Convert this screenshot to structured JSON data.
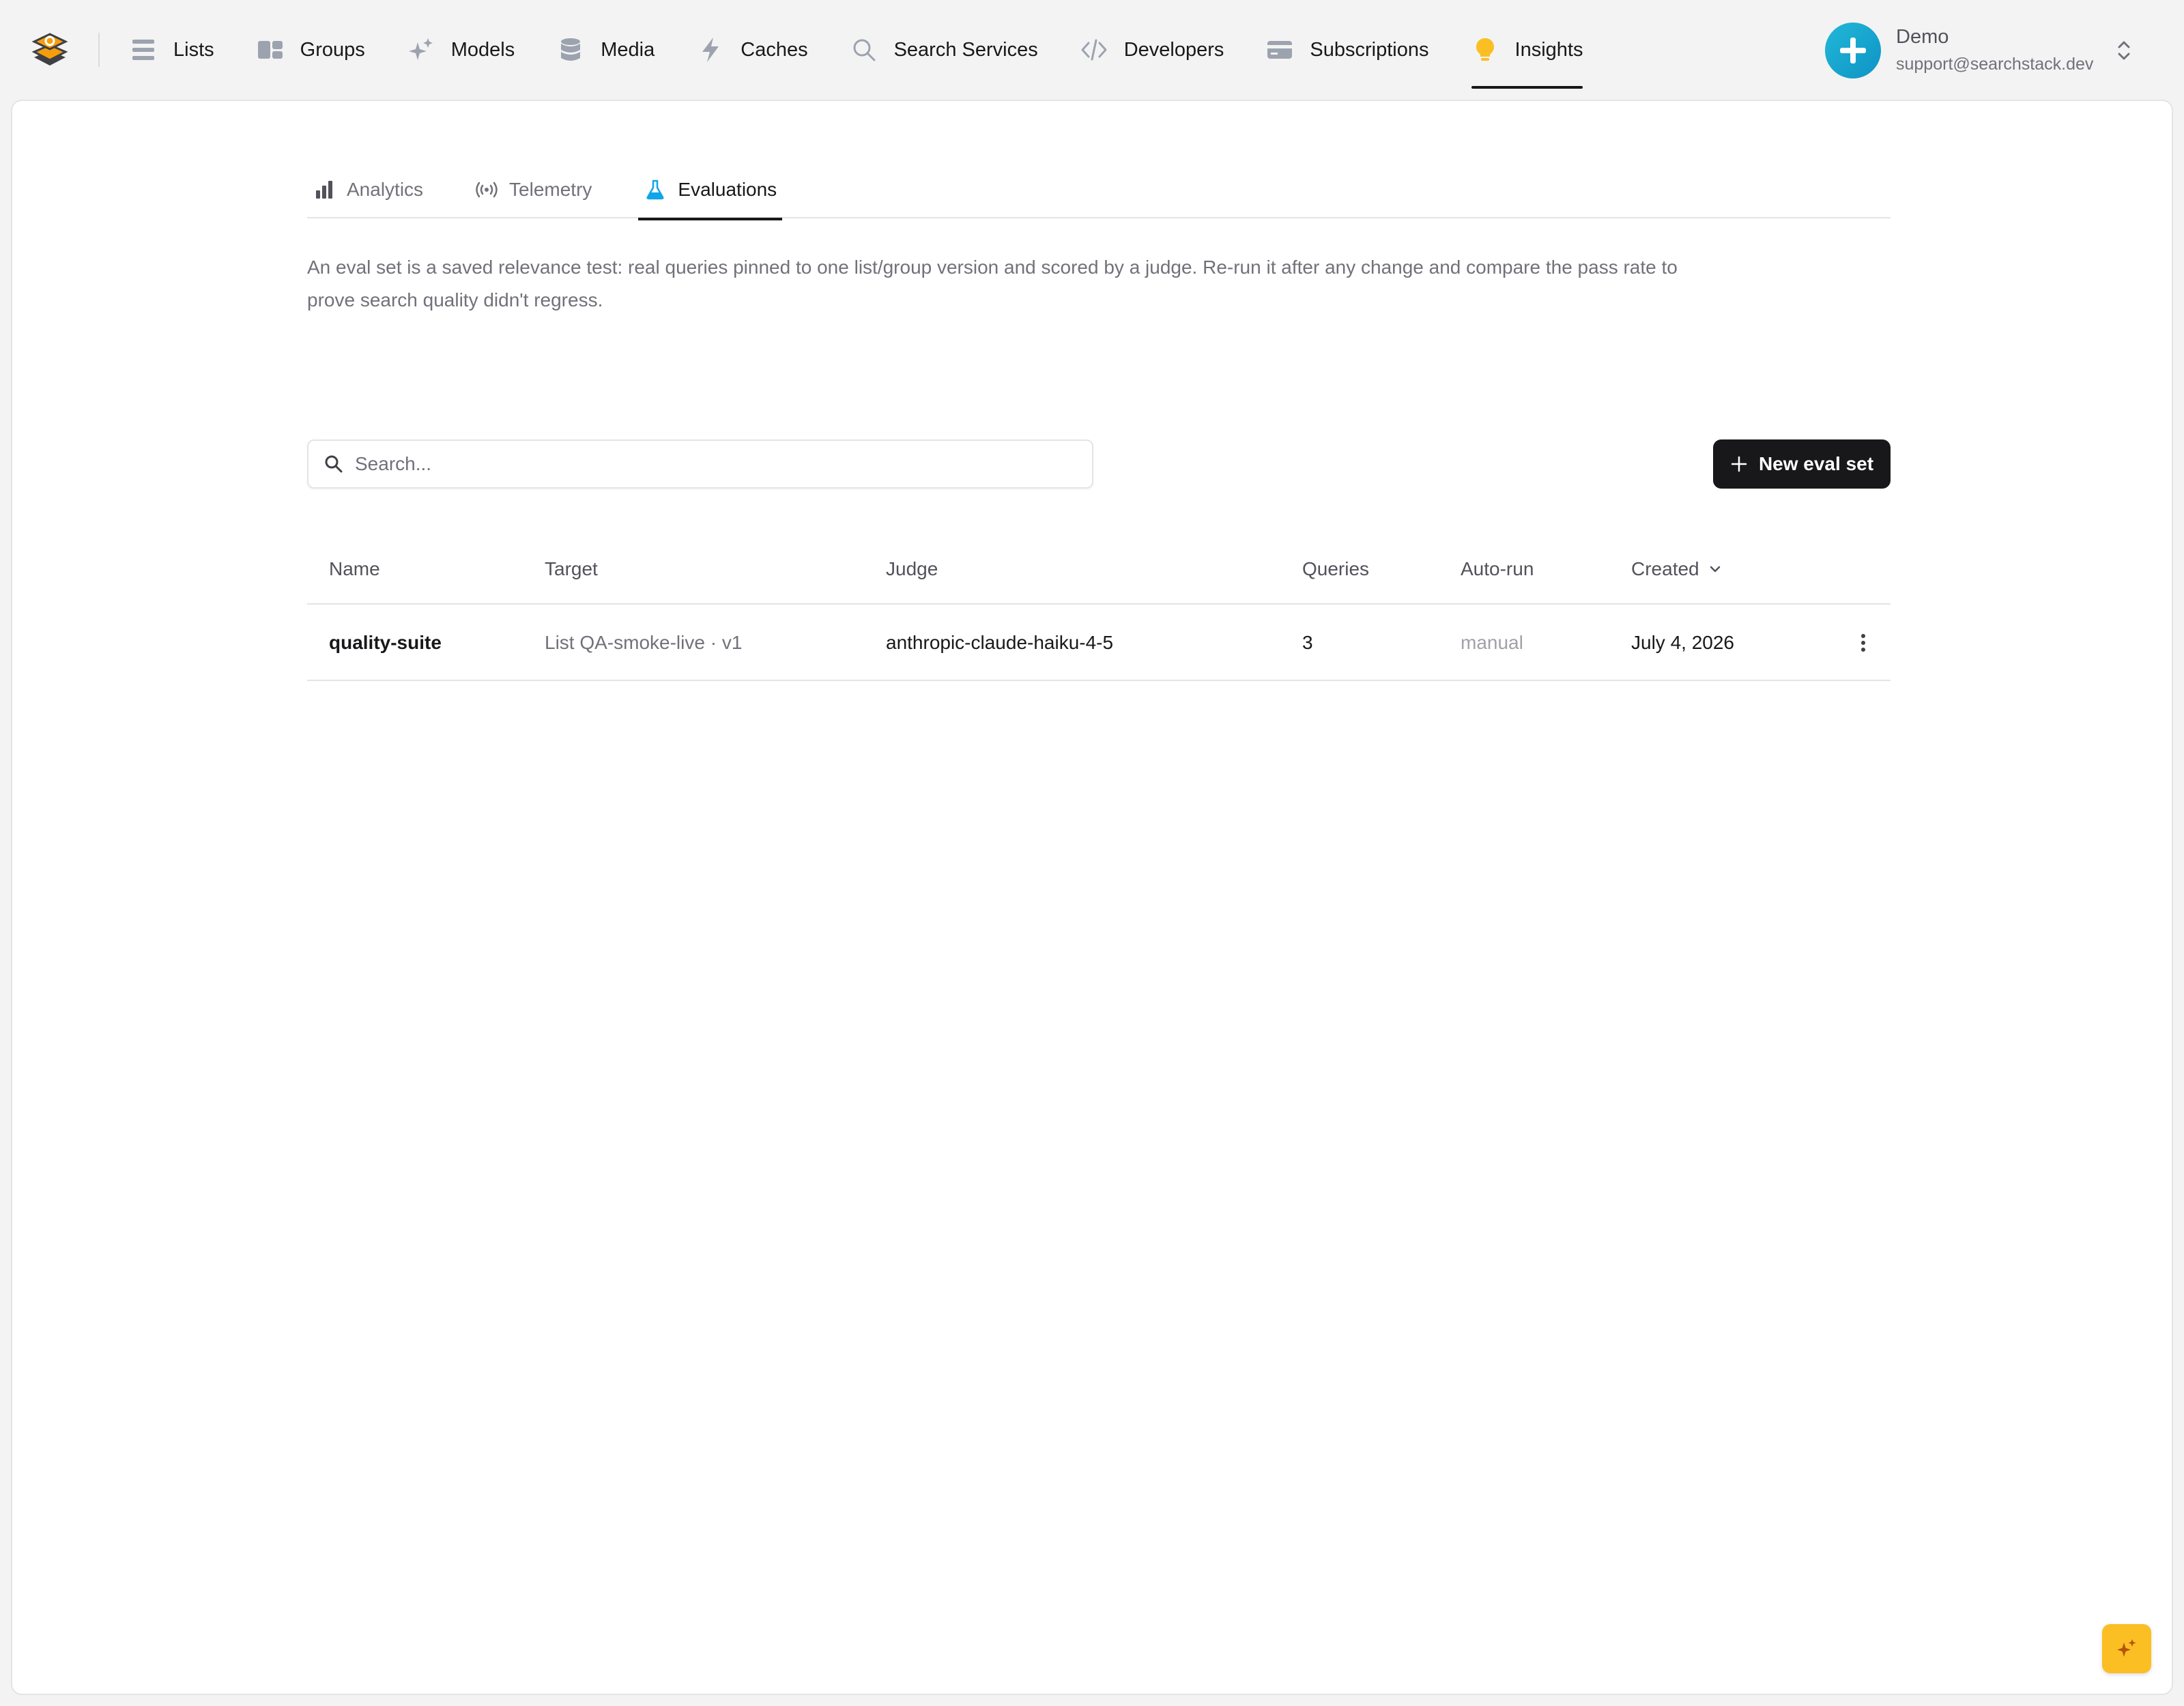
{
  "nav": {
    "items": [
      {
        "label": "Lists",
        "icon": "list-icon"
      },
      {
        "label": "Groups",
        "icon": "groups-icon"
      },
      {
        "label": "Models",
        "icon": "sparkles-icon"
      },
      {
        "label": "Media",
        "icon": "database-icon"
      },
      {
        "label": "Caches",
        "icon": "bolt-icon"
      },
      {
        "label": "Search Services",
        "icon": "search-icon"
      },
      {
        "label": "Developers",
        "icon": "code-icon"
      },
      {
        "label": "Subscriptions",
        "icon": "credit-card-icon"
      },
      {
        "label": "Insights",
        "icon": "lightbulb-icon",
        "active": true
      }
    ]
  },
  "user": {
    "name": "Demo",
    "email": "support@searchstack.dev"
  },
  "tabs": [
    {
      "label": "Analytics",
      "icon": "bar-chart-icon"
    },
    {
      "label": "Telemetry",
      "icon": "broadcast-icon"
    },
    {
      "label": "Evaluations",
      "icon": "flask-icon",
      "active": true
    }
  ],
  "description": "An eval set is a saved relevance test: real queries pinned to one list/group version and scored by a judge. Re-run it after any change and compare the pass rate to prove search quality didn't regress.",
  "search": {
    "placeholder": "Search..."
  },
  "new_button": {
    "label": "New eval set"
  },
  "table": {
    "headers": {
      "name": "Name",
      "target": "Target",
      "judge": "Judge",
      "queries": "Queries",
      "autorun": "Auto-run",
      "created": "Created"
    },
    "rows": [
      {
        "name": "quality-suite",
        "target": "List QA-smoke-live · v1",
        "judge": "anthropic-claude-haiku-4-5",
        "queries": "3",
        "autorun": "manual",
        "created": "July 4, 2026"
      }
    ]
  },
  "colors": {
    "brand": "#f59e0b",
    "avatar": "#14a8cf",
    "primary_button": "#18181b",
    "accent_tab_icon": "#0ea5e9",
    "fab": "#fbbf24"
  }
}
